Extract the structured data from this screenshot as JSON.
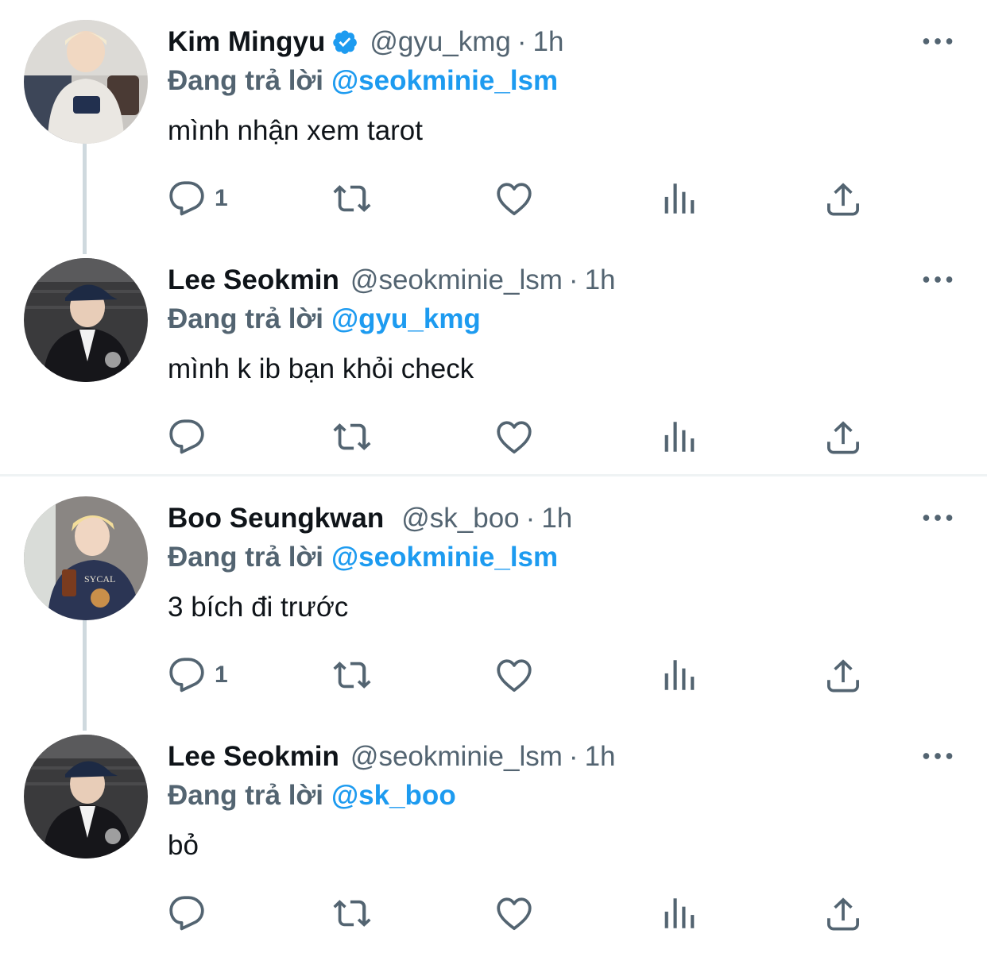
{
  "reply_prefix": "Đang trả lời",
  "colors": {
    "accent": "#1d9bf0",
    "muted": "#536471",
    "text": "#0f1419"
  },
  "tweets": [
    {
      "name": "Kim Mingyu",
      "verified": true,
      "handle": "@gyu_kmg",
      "dot": "·",
      "time": "1h",
      "reply_to": "@seokminie_lsm",
      "text": "mình nhận xem tarot",
      "reply_count": "1"
    },
    {
      "name": "Lee Seokmin",
      "verified": false,
      "handle": "@seokminie_lsm",
      "dot": "·",
      "time": "1h",
      "reply_to": "@gyu_kmg",
      "text": "mình k ib bạn khỏi check",
      "reply_count": ""
    },
    {
      "name": "Boo Seungkwan",
      "verified": false,
      "handle": "@sk_boo",
      "dot": "·",
      "time": "1h",
      "reply_to": "@seokminie_lsm",
      "text": "3 bích đi trước",
      "reply_count": "1"
    },
    {
      "name": "Lee Seokmin",
      "verified": false,
      "handle": "@seokminie_lsm",
      "dot": "·",
      "time": "1h",
      "reply_to": "@sk_boo",
      "text": "bỏ",
      "reply_count": ""
    }
  ]
}
